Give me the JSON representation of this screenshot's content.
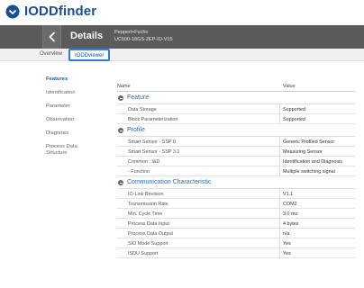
{
  "app": {
    "title": "IODDfinder"
  },
  "header": {
    "page_title": "Details",
    "vendor": "Pepperl+Fuchs",
    "device": "UC500-18GS-2EP-IO-V15"
  },
  "tabs": [
    {
      "label": "Overview",
      "active": false
    },
    {
      "label": "IODDviewer",
      "active": true
    }
  ],
  "nav": [
    {
      "label": "Features",
      "active": true
    },
    {
      "label": "Identification",
      "active": false
    },
    {
      "label": "Parameter",
      "active": false
    },
    {
      "label": "Observation",
      "active": false
    },
    {
      "label": "Diagnosis",
      "active": false
    },
    {
      "label": "Process Data Structure",
      "active": false
    }
  ],
  "table": {
    "col_name": "Name",
    "col_value": "Value",
    "sections": [
      {
        "label": "Feature",
        "rows": [
          {
            "name": "Data Storage",
            "value": "Supported"
          },
          {
            "name": "Block Parameterization",
            "value": "Supported"
          }
        ]
      },
      {
        "label": "Profile",
        "rows": [
          {
            "name": "Smart Sensor - SSP 0",
            "value": "Generic Profiled Sensor"
          },
          {
            "name": "Smart Sensor - SSP 3.1",
            "value": "Measuring Sensor"
          },
          {
            "name": "Common : I&D",
            "value": "Identification and Diagnosis"
          },
          {
            "name": "- Function",
            "value": "Multiple switching signal"
          }
        ]
      },
      {
        "label": "Communication Characteristic",
        "rows": [
          {
            "name": "IO-Link Revision",
            "value": "V1.1"
          },
          {
            "name": "Transmission Rate",
            "value": "COM2"
          },
          {
            "name": "Min. Cycle Time",
            "value": "3.0 ms"
          },
          {
            "name": "Process Data Input",
            "value": "4 bytes"
          },
          {
            "name": "Process Data Output",
            "value": "n/a"
          },
          {
            "name": "SIO Mode Support",
            "value": "Yes"
          },
          {
            "name": "ISDU Support",
            "value": "Yes"
          }
        ]
      }
    ]
  },
  "colors": {
    "brand": "#1a4f95",
    "header_bg": "#5b5b5b",
    "active_tab_border": "#2d7ed8",
    "section_label": "#2c6fb5"
  }
}
